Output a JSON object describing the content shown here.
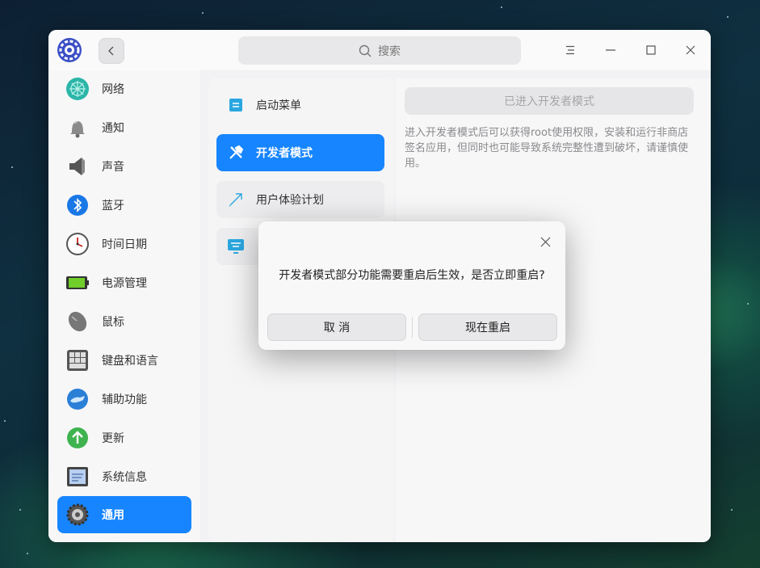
{
  "titlebar": {
    "search_placeholder": "搜索"
  },
  "sidebar": {
    "items": [
      {
        "label": "网络",
        "icon": "network-icon"
      },
      {
        "label": "通知",
        "icon": "bell-icon"
      },
      {
        "label": "声音",
        "icon": "speaker-icon"
      },
      {
        "label": "蓝牙",
        "icon": "bluetooth-icon"
      },
      {
        "label": "时间日期",
        "icon": "clock-icon"
      },
      {
        "label": "电源管理",
        "icon": "battery-icon"
      },
      {
        "label": "鼠标",
        "icon": "mouse-icon"
      },
      {
        "label": "键盘和语言",
        "icon": "keyboard-icon"
      },
      {
        "label": "辅助功能",
        "icon": "accessibility-icon"
      },
      {
        "label": "更新",
        "icon": "update-arrow-icon"
      },
      {
        "label": "系统信息",
        "icon": "system-info-icon"
      },
      {
        "label": "通用",
        "icon": "gear-icon",
        "active": true
      }
    ]
  },
  "middle": {
    "items": [
      {
        "label": "启动菜单",
        "icon": "boot-menu-icon"
      },
      {
        "label": "开发者模式",
        "icon": "tools-icon",
        "active": true
      },
      {
        "label": "用户体验计划",
        "icon": "trend-icon"
      },
      {
        "label": "",
        "icon": "diagnostics-icon"
      }
    ]
  },
  "right": {
    "developer_button": "已进入开发者模式",
    "description": "进入开发者模式后可以获得root使用权限，安装和运行非商店签名应用，但同时也可能导致系统完整性遭到破坏，请谨慎使用。"
  },
  "dialog": {
    "message": "开发者模式部分功能需要重启后生效，是否立即重启?",
    "cancel_label": "取 消",
    "confirm_label": "现在重启"
  },
  "colors": {
    "accent": "#1685ff",
    "window_bg": "#f2f2f4"
  }
}
